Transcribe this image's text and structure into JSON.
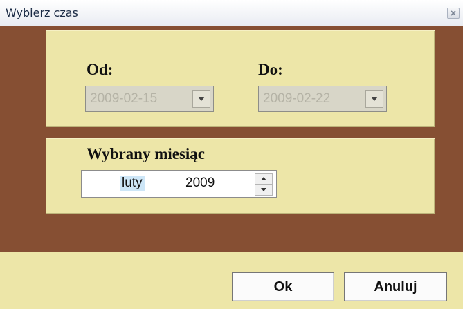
{
  "window": {
    "title": "Wybierz czas"
  },
  "range": {
    "from_label": "Od:",
    "from_value": "2009-02-15",
    "to_label": "Do:",
    "to_value": "2009-02-22"
  },
  "month_picker": {
    "label": "Wybrany miesiąc",
    "month": "luty",
    "year": "2009"
  },
  "buttons": {
    "ok": "Ok",
    "cancel": "Anuluj"
  },
  "colors": {
    "frame_brown": "#864f33",
    "panel_beige": "#ede6a8",
    "selection_highlight": "#cde6f7"
  }
}
